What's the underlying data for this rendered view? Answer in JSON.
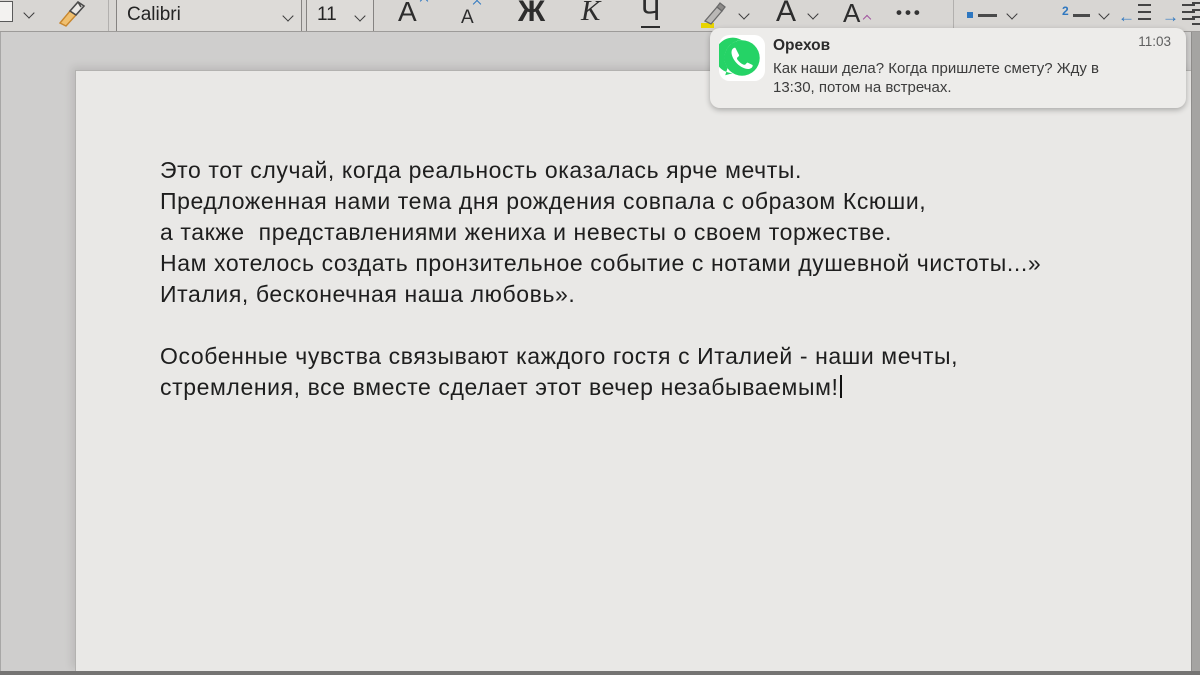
{
  "toolbar": {
    "font_name": "Calibri",
    "font_size": "11",
    "grow_font": "А",
    "shrink_font": "А",
    "bold": "Ж",
    "italic": "К",
    "underline": "Ч",
    "font_color": "А",
    "text_effects": "А",
    "more": "•••",
    "numbering_digit": "2"
  },
  "notification": {
    "time": "11:03",
    "sender": "Орехов",
    "message_lines": [
      "Как наши дела? Когда пришлете смету? Жду в",
      "13:30, потом на встречах."
    ]
  },
  "document": {
    "lines": [
      "Это тот случай, когда реальность оказалась ярче мечты.",
      "Предложенная нами тема дня рождения совпала с образом Ксюши,",
      "а также  представлениями жениха и невесты о своем торжестве.",
      "Нам хотелось создать пронзительное событие с нотами душевной чистоты...»",
      "Италия, бесконечная наша любовь».",
      "",
      "Особенные чувства связывают каждого гостя с Италией - наши мечты,",
      "стремления, все вместе сделает этот вечер незабываемым!"
    ]
  },
  "colors": {
    "accent_blue": "#2e77c0",
    "accent_purple": "#a0529f",
    "highlight_yellow": "#e8d400",
    "whatsapp_green": "#25d366",
    "toolbar_bg": "#d8d6d3",
    "page_bg": "#e9e8e6"
  }
}
